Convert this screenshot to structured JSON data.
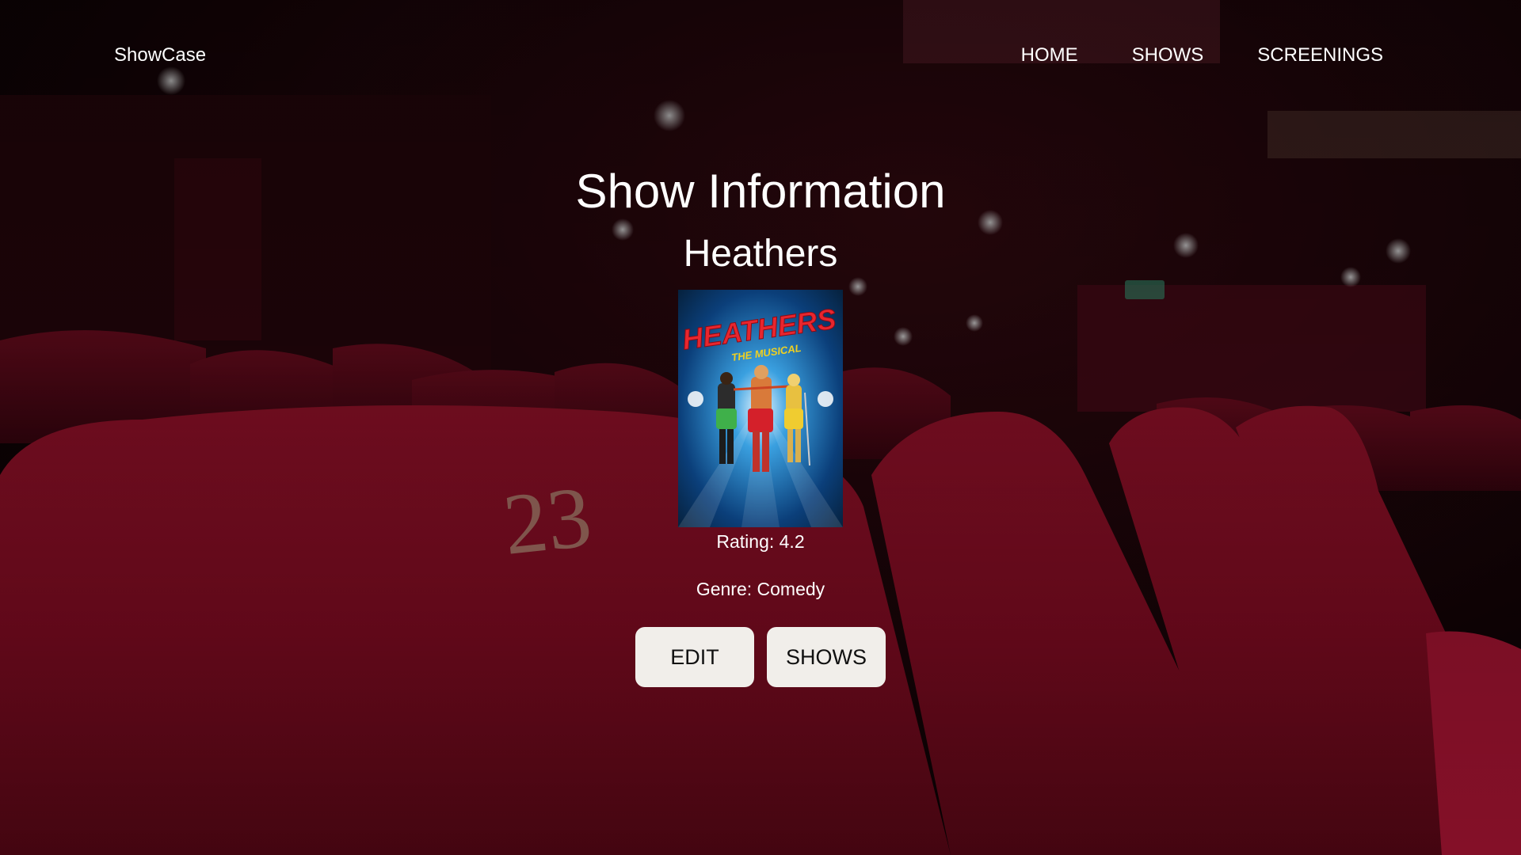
{
  "header": {
    "brand": "ShowCase",
    "nav": [
      {
        "label": "HOME"
      },
      {
        "label": "SHOWS"
      },
      {
        "label": "SCREENINGS"
      }
    ]
  },
  "main": {
    "title": "Show Information",
    "show_name": "Heathers",
    "poster": {
      "title_text": "HEATHERS",
      "subtitle_text": "THE MUSICAL"
    },
    "rating_text": "Rating: 4.2",
    "genre_text": "Genre: Comedy",
    "actions": {
      "edit_label": "EDIT",
      "shows_label": "SHOWS"
    }
  },
  "colors": {
    "seat_red": "#8e0f27",
    "button_bg": "#f1eeea",
    "text": "#ffffff"
  }
}
